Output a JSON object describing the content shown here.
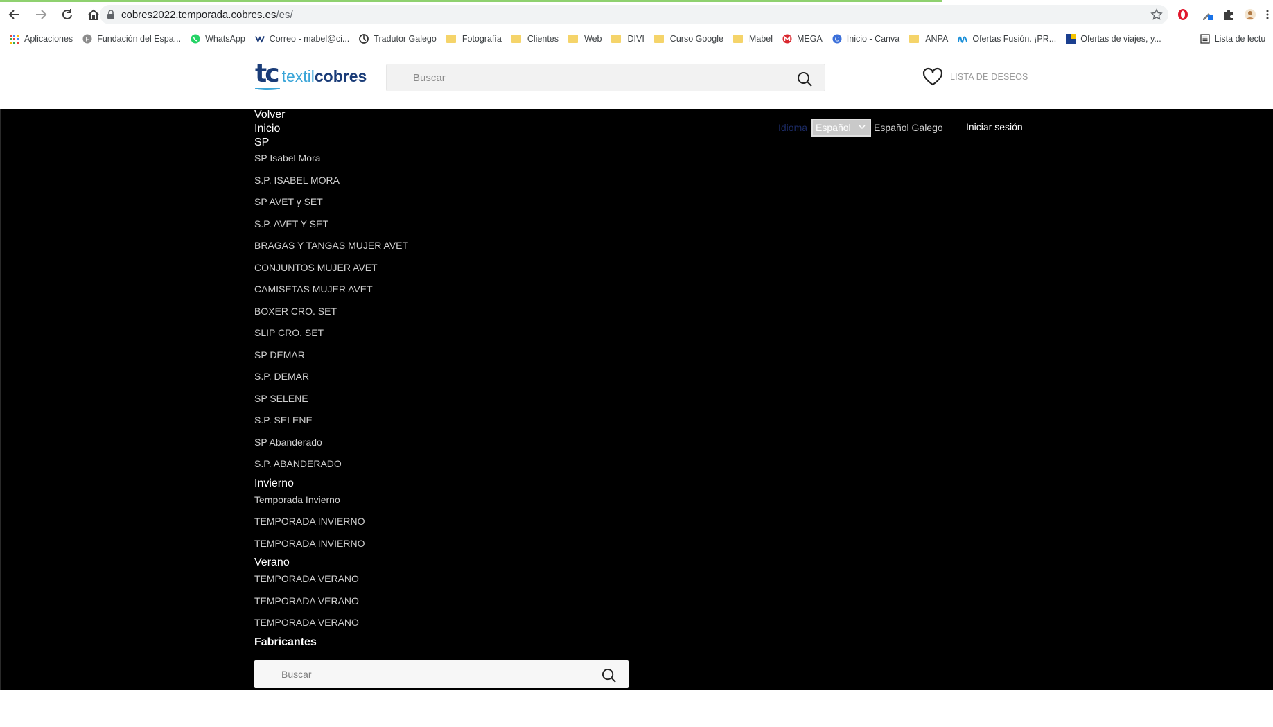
{
  "browser": {
    "url_host": "cobres2022.temporada.cobres.es",
    "url_path": "/es/",
    "bookmarks": [
      {
        "label": "Aplicaciones",
        "icon": "apps-grid-icon"
      },
      {
        "label": "Fundación del Espa...",
        "icon": "site-favicon"
      },
      {
        "label": "WhatsApp",
        "icon": "whatsapp-icon"
      },
      {
        "label": "Correo - mabel@ci...",
        "icon": "mail-icon"
      },
      {
        "label": "Tradutor Galego",
        "icon": "translate-icon"
      },
      {
        "label": "Fotografía",
        "icon": "folder-icon"
      },
      {
        "label": "Clientes",
        "icon": "folder-icon"
      },
      {
        "label": "Web",
        "icon": "folder-icon"
      },
      {
        "label": "DIVI",
        "icon": "folder-icon"
      },
      {
        "label": "Curso Google",
        "icon": "folder-icon"
      },
      {
        "label": "Mabel",
        "icon": "folder-icon"
      },
      {
        "label": "MEGA",
        "icon": "mega-icon"
      },
      {
        "label": "Inicio - Canva",
        "icon": "canva-icon"
      },
      {
        "label": "ANPA",
        "icon": "folder-icon"
      },
      {
        "label": "Ofertas Fusión. ¡PR...",
        "icon": "movistar-icon"
      },
      {
        "label": "Ofertas de viajes, y...",
        "icon": "travel-icon"
      },
      {
        "label": "Lista de lectu",
        "icon": "reading-list-icon"
      }
    ]
  },
  "header": {
    "logo_mark": "tc",
    "logo_word_1": "textil",
    "logo_word_2": "cobres",
    "search_placeholder": "Buscar",
    "wishlist_label": "LISTA DE DESEOS"
  },
  "menu": {
    "back": "Volver",
    "home": "Inicio",
    "sections": [
      {
        "title": "SP",
        "items": [
          "SP Isabel Mora",
          "S.P. ISABEL MORA",
          "SP AVET y SET",
          "S.P. AVET Y SET",
          "BRAGAS Y TANGAS MUJER AVET",
          "CONJUNTOS MUJER AVET",
          "CAMISETAS MUJER AVET",
          "BOXER CRO. SET",
          "SLIP CRO. SET",
          "SP DEMAR",
          "S.P. DEMAR",
          "SP SELENE",
          "S.P. SELENE",
          "SP Abanderado",
          "S.P. ABANDERADO"
        ]
      },
      {
        "title": "Invierno",
        "items": [
          "Temporada Invierno",
          "TEMPORADA INVIERNO",
          "TEMPORADA INVIERNO"
        ]
      },
      {
        "title": "Verano",
        "items": [
          "TEMPORADA VERANO",
          "TEMPORADA VERANO",
          "TEMPORADA VERANO"
        ]
      }
    ],
    "manufacturers": "Fabricantes",
    "search_placeholder": "Buscar"
  },
  "language": {
    "label": "Idioma",
    "selected": "Español",
    "options_text": "Español Galego"
  },
  "login_label": "Iniciar sesión",
  "colors": {
    "menu_bg": "#000000",
    "logo_dark": "#1a3c78",
    "logo_light": "#3aa5d8"
  }
}
